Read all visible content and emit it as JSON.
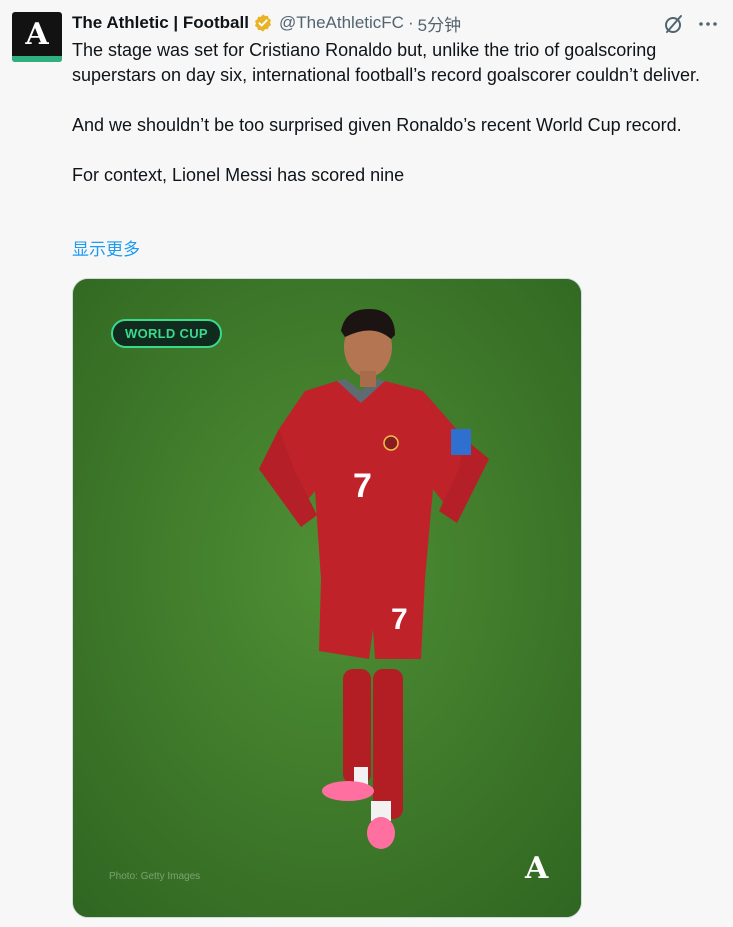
{
  "account": {
    "display_name": "The Athletic | Football",
    "handle": "@TheAthleticFC",
    "separator": "·",
    "timestamp": "5分钟",
    "avatar_icon": "athletic-logo-icon",
    "verified_color": "#e8b427"
  },
  "tweet": {
    "paragraphs": [
      "The stage was set for Cristiano Ronaldo but, unlike the trio of goalscoring superstars on day six, international football’s record goalscorer couldn’t deliver.",
      "And we shouldn’t be too surprised given Ronaldo’s recent World Cup record.",
      "For context, Lionel Messi has scored nine"
    ],
    "show_more": "显示更多"
  },
  "media": {
    "badge": "WORLD CUP",
    "credit": "Photo: Getty Images",
    "player_number": "7",
    "description_icon": "photo-player-icon"
  },
  "colors": {
    "link": "#1d9bf0",
    "secondary_text": "#536471",
    "badge_green": "#3ad98e"
  }
}
